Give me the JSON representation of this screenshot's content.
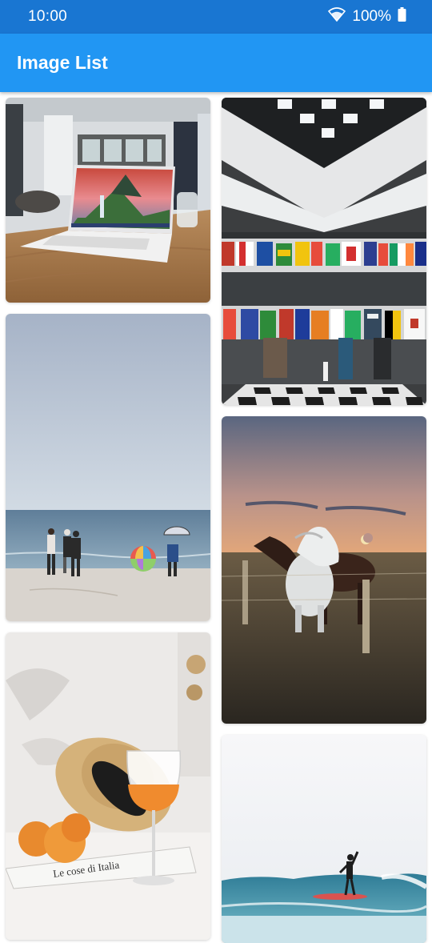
{
  "status_bar": {
    "time": "10:00",
    "battery_percent": "100%",
    "icons": [
      "wifi-icon",
      "battery-icon"
    ]
  },
  "app_bar": {
    "title": "Image List",
    "background_color": "#2196f3",
    "status_color": "#1976d2"
  },
  "gallery": {
    "left_column": [
      {
        "subject": "laptop-on-wooden-table"
      },
      {
        "subject": "people-on-beach-with-umbrella"
      },
      {
        "subject": "straw-hat-peaches-and-drink"
      }
    ],
    "right_column": [
      {
        "subject": "atrium-with-international-flags"
      },
      {
        "subject": "horses-in-field-at-dusk"
      },
      {
        "subject": "surfer-on-wave"
      }
    ],
    "featured_text": {
      "newspaper_headline": "Le cose di Italia"
    }
  }
}
